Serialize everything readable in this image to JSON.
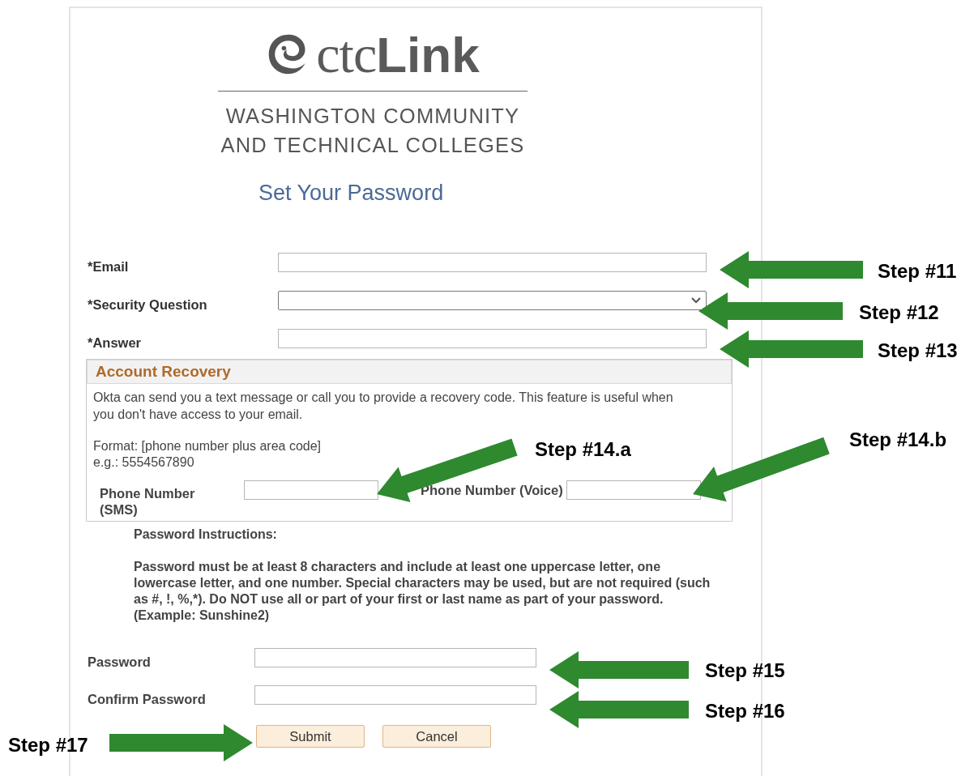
{
  "logo": {
    "text_light": "ctc",
    "text_bold": "Link",
    "subtitle_lines": [
      "WASHINGTON COMMUNITY",
      "AND TECHNICAL COLLEGES"
    ]
  },
  "title": "Set Your Password",
  "fields": [
    {
      "label": "*Email",
      "kind": "text"
    },
    {
      "label": "*Security Question",
      "kind": "select"
    },
    {
      "label": "*Answer",
      "kind": "text"
    }
  ],
  "account_recovery": {
    "title": "Account Recovery",
    "description": "Okta can send you a text message or call you to provide a recovery code. This feature is useful when you don't have access to your email.",
    "format_lines": [
      "Format: [phone number plus area code]",
      "e.g.: 5554567890"
    ],
    "phone_fields": [
      {
        "label": "Phone Number (SMS)"
      },
      {
        "label": "Phone Number (Voice)"
      }
    ]
  },
  "password_instructions": {
    "heading": "Password Instructions:",
    "text": "Password must be at least 8 characters and include at least one uppercase letter, one lowercase letter, and one number. Special characters may be used, but are not required (such as #, !, %,*). Do NOT use all or part of your first or last name as part of your password. (Example:  Sunshine2)"
  },
  "password_fields": [
    {
      "label": "Password"
    },
    {
      "label": "Confirm Password"
    }
  ],
  "buttons": [
    "Submit",
    "Cancel"
  ],
  "annotations": [
    {
      "label": "Step #11"
    },
    {
      "label": "Step #12"
    },
    {
      "label": "Step #13"
    },
    {
      "label": "Step #14.a"
    },
    {
      "label": "Step #14.b"
    },
    {
      "label": "Step #15"
    },
    {
      "label": "Step #16"
    },
    {
      "label": "Step #17"
    }
  ]
}
